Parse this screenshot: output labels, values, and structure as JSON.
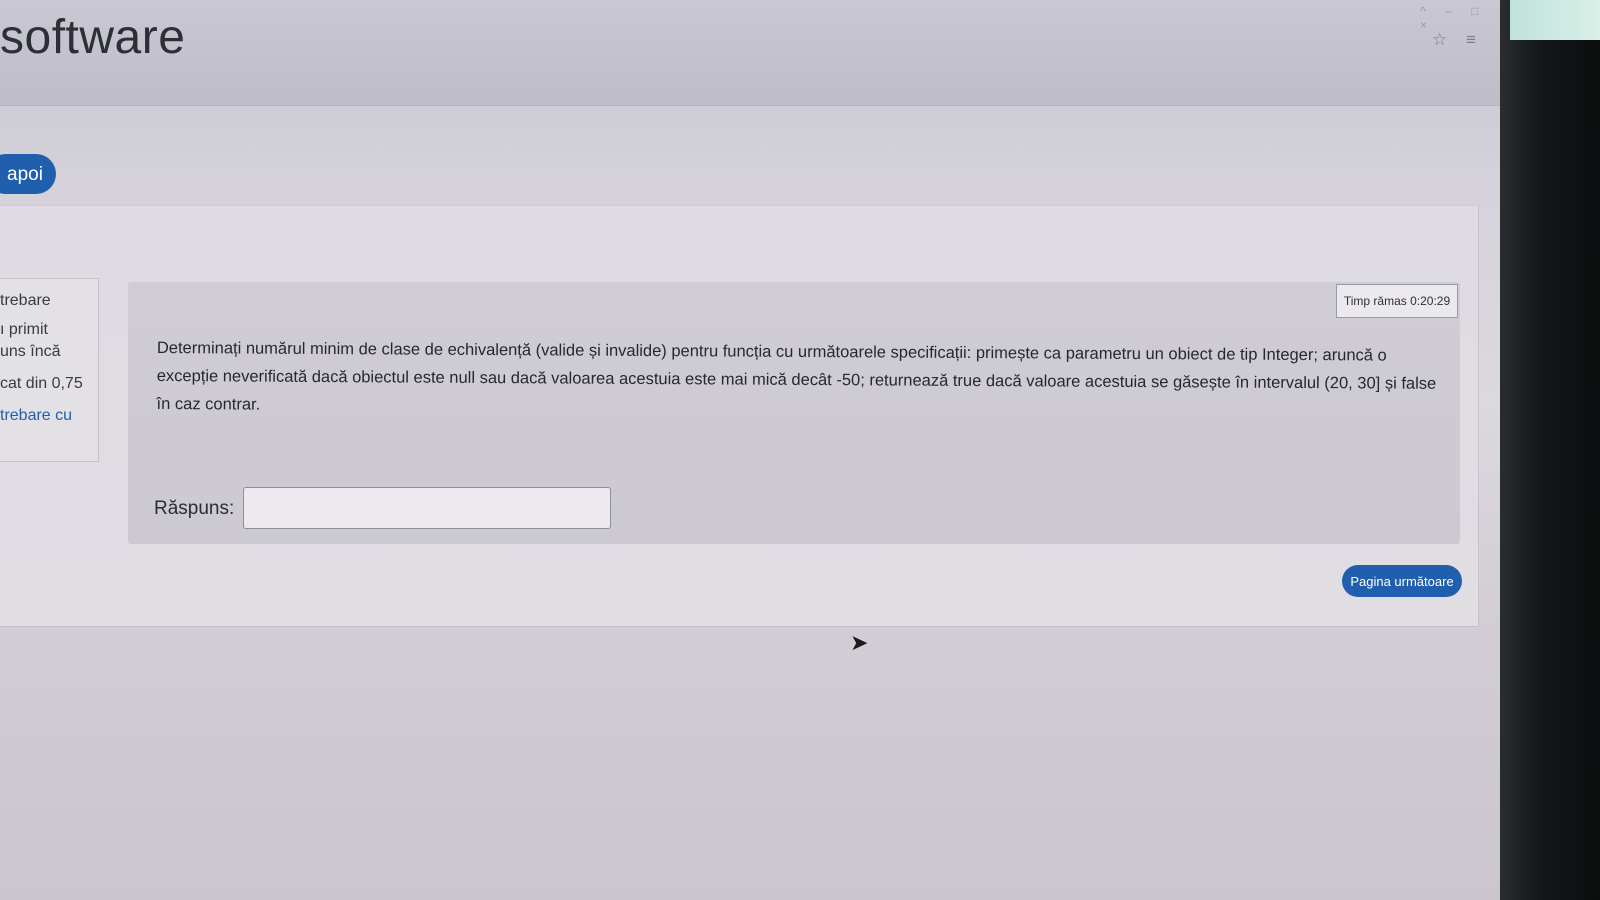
{
  "header": {
    "site_title": "software",
    "window_controls": "^ – □ ×",
    "star_icon": "☆",
    "menu_icon": "≡"
  },
  "nav": {
    "back_label": "apoi"
  },
  "question_info": {
    "line1": "trebare",
    "line2": "ı primit",
    "line3": "uns încă",
    "line4": "cat din 0,75",
    "line5": "trebare cu"
  },
  "timer": {
    "label": "Timp rămas 0:20:29"
  },
  "question": {
    "text": "Determinați numărul minim de clase de echivalență (valide și invalide) pentru funcția cu următoarele specificații: primește ca parametru un obiect de tip Integer; aruncă o excepție neverificată dacă obiectul este null sau dacă valoarea acestuia este mai mică decât -50; returnează true dacă valoare acestuia se găsește în intervalul (20, 30] și false în caz contrar.",
    "answer_label": "Răspuns:",
    "answer_value": ""
  },
  "footer": {
    "next_label": "Pagina următoare"
  },
  "colors": {
    "accent": "#1f5fae",
    "panel": "#d0ccd5",
    "text": "#27282e"
  }
}
